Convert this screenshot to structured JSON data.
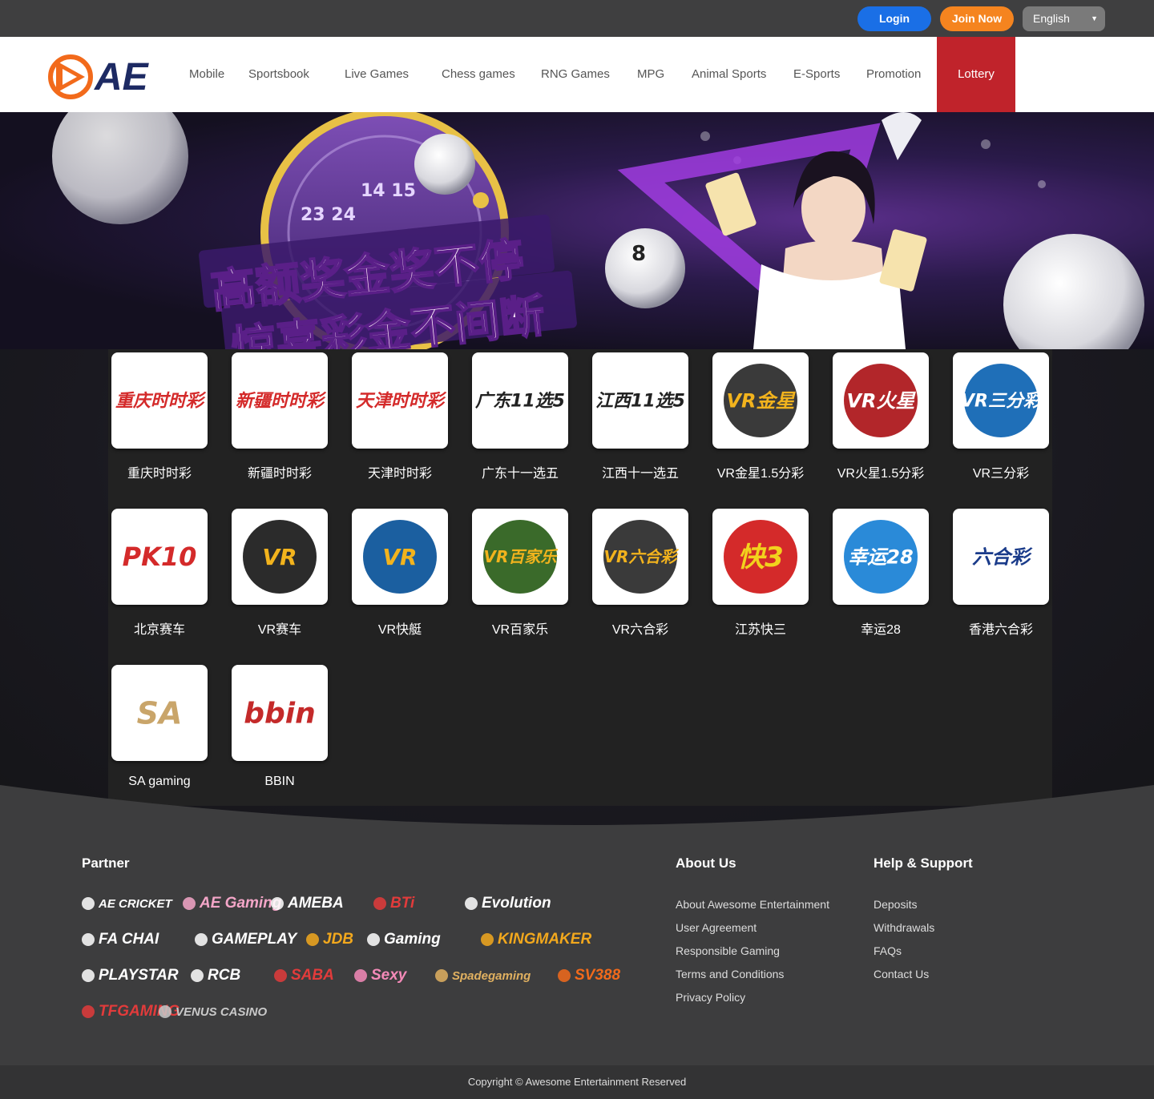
{
  "topbar": {
    "login_label": "Login",
    "join_label": "Join Now",
    "language": "English"
  },
  "header": {
    "logo_text": "AE",
    "nav": [
      {
        "label": "Mobile"
      },
      {
        "label": "Sportsbook"
      },
      {
        "label": "Live Games"
      },
      {
        "label": "Chess games"
      },
      {
        "label": "RNG Games"
      },
      {
        "label": "MPG"
      },
      {
        "label": "Animal Sports"
      },
      {
        "label": "E-Sports"
      },
      {
        "label": "Promotion"
      },
      {
        "label": "Lottery",
        "active": true
      }
    ]
  },
  "banner": {
    "headline_line1": "高额奖金奖不停",
    "headline_line2": "惊喜彩金不间断"
  },
  "games": [
    {
      "label": "重庆时时彩",
      "tile_text": "重庆时时彩",
      "icon": "cq-ssc-logo"
    },
    {
      "label": "新疆时时彩",
      "tile_text": "新疆时时彩",
      "icon": "xj-ssc-logo"
    },
    {
      "label": "天津时时彩",
      "tile_text": "天津时时彩",
      "icon": "tj-ssc-logo"
    },
    {
      "label": "广东十一选五",
      "tile_text": "广东11选5",
      "icon": "gd-11x5-logo"
    },
    {
      "label": "江西十一选五",
      "tile_text": "江西11选5",
      "icon": "jx-11x5-logo"
    },
    {
      "label": "VR金星1.5分彩",
      "tile_text": "VR金星",
      "icon": "vr-venus-logo"
    },
    {
      "label": "VR火星1.5分彩",
      "tile_text": "VR火星",
      "icon": "vr-mars-logo"
    },
    {
      "label": "VR三分彩",
      "tile_text": "VR三分彩",
      "icon": "vr-3min-logo"
    },
    {
      "label": "北京赛车",
      "tile_text": "PK10",
      "icon": "pk10-logo"
    },
    {
      "label": "VR赛车",
      "tile_text": "VR",
      "icon": "vr-racing-logo"
    },
    {
      "label": "VR快艇",
      "tile_text": "VR",
      "icon": "vr-boat-logo"
    },
    {
      "label": "VR百家乐",
      "tile_text": "VR百家乐",
      "icon": "vr-baccarat-logo"
    },
    {
      "label": "VR六合彩",
      "tile_text": "VR六合彩",
      "icon": "vr-marksix-logo"
    },
    {
      "label": "江苏快三",
      "tile_text": "快3",
      "icon": "js-k3-logo"
    },
    {
      "label": "幸运28",
      "tile_text": "幸运28",
      "icon": "lucky28-logo"
    },
    {
      "label": "香港六合彩",
      "tile_text": "六合彩",
      "icon": "hk-marksix-logo"
    },
    {
      "label": "SA gaming",
      "tile_text": "SA",
      "icon": "sa-gaming-logo"
    },
    {
      "label": "BBIN",
      "tile_text": "bbin",
      "icon": "bbin-logo"
    }
  ],
  "footer": {
    "partner_title": "Partner",
    "partners": [
      {
        "name": "AE CRICKET",
        "color": "#ffffff"
      },
      {
        "name": "AE Gaming",
        "color": "#f4a6c8"
      },
      {
        "name": "AMEBA",
        "color": "#ffffff"
      },
      {
        "name": "BTi",
        "color": "#e23b3b"
      },
      {
        "name": "Evolution",
        "color": "#ffffff"
      },
      {
        "name": "FA CHAI",
        "color": "#ffffff"
      },
      {
        "name": "GAMEPLAY",
        "color": "#ffffff"
      },
      {
        "name": "JDB",
        "color": "#f2a81d"
      },
      {
        "name": "Gaming",
        "color": "#ffffff"
      },
      {
        "name": "KINGMAKER",
        "color": "#f2a81d"
      },
      {
        "name": "PLAYSTAR",
        "color": "#ffffff"
      },
      {
        "name": "RCB",
        "color": "#ffffff"
      },
      {
        "name": "SABA",
        "color": "#e23b3b"
      },
      {
        "name": "Sexy",
        "color": "#f48ab8"
      },
      {
        "name": "Spadegaming",
        "color": "#e0b060"
      },
      {
        "name": "SV388",
        "color": "#f26a1b"
      },
      {
        "name": "TFGAMING",
        "color": "#e23b3b"
      },
      {
        "name": "VENUS CASINO",
        "color": "#c9c9c9"
      }
    ],
    "about_title": "About Us",
    "about_links": [
      "About Awesome Entertainment",
      "User Agreement",
      "Responsible Gaming",
      "Terms and Conditions",
      "Privacy Policy"
    ],
    "help_title": "Help & Support",
    "help_links": [
      "Deposits",
      "Withdrawals",
      "FAQs",
      "Contact Us"
    ],
    "copyright": "Copyright © Awesome Entertainment Reserved"
  },
  "colors": {
    "login": "#1a6fe6",
    "join": "#f5841f",
    "nav_active": "#c0232b",
    "logo_orange": "#f26a1b"
  }
}
